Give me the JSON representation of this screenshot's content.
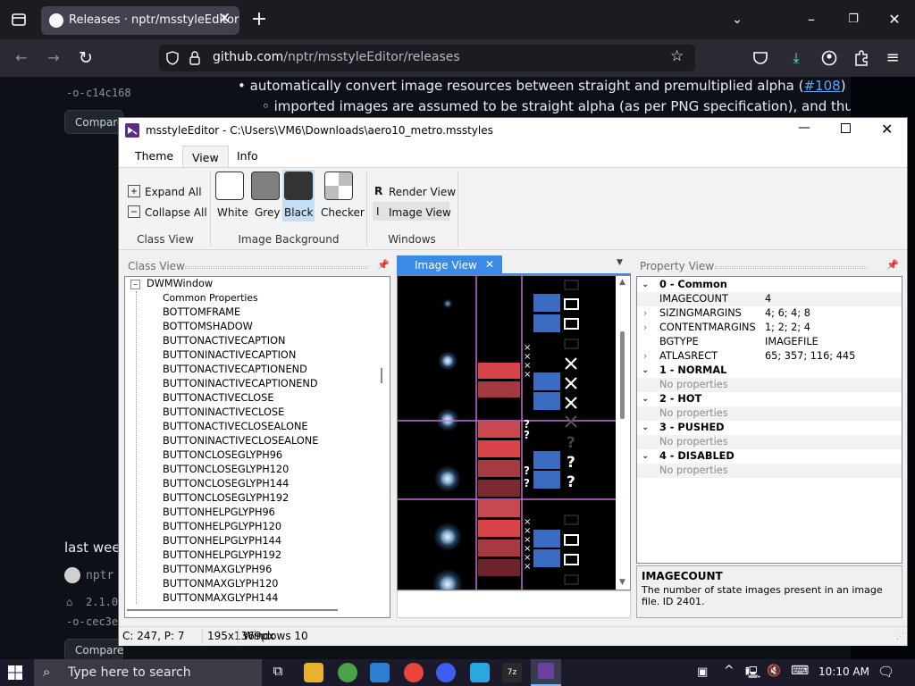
{
  "browser": {
    "tab_title": "Releases · nptr/msstyleEditor",
    "url_domain": "github.com",
    "url_path": "/nptr/msstyleEditor/releases"
  },
  "github": {
    "left_top1": "c14c168",
    "left_compare_top": "Compare",
    "left_last_week": "last week",
    "left_author": "nptr",
    "left_version": "2.1.0",
    "left_commit": "cec3e",
    "left_compare_bottom": "Compare",
    "bullet1_text": "automatically convert image resources between straight and premultiplied alpha (",
    "bullet1_link": "#108",
    "bullet1_end": ")",
    "bullet2_text": "imported images are assumed to be straight alpha (as per PNG specification), and thus"
  },
  "app": {
    "title": "msstyleEditor - C:\\Users\\VM6\\Downloads\\aero10_metro.msstyles",
    "ribbon_tabs": [
      "Theme",
      "View",
      "Info"
    ],
    "active_tab": "View",
    "class_view_group": {
      "expand_all": "Expand All",
      "collapse_all": "Collapse All",
      "label": "Class View"
    },
    "image_background_group": {
      "label": "Image Background",
      "options": [
        {
          "label": "White",
          "color": "#ffffff"
        },
        {
          "label": "Grey",
          "color": "#808080"
        },
        {
          "label": "Black",
          "color": "#333333"
        },
        {
          "label": "Checker",
          "color": "#c0c0c0"
        }
      ],
      "selected": "Black"
    },
    "windows_group": {
      "render_view": "Render View",
      "image_view": "Image View",
      "label": "Windows",
      "render_prefix": "R",
      "image_prefix": "I"
    },
    "class_view": {
      "title": "Class View",
      "root": "DWMWindow",
      "items": [
        "Common Properties",
        "BOTTOMFRAME",
        "BOTTOMSHADOW",
        "BUTTONACTIVECAPTION",
        "BUTTONINACTIVECAPTION",
        "BUTTONACTIVECAPTIONEND",
        "BUTTONINACTIVECAPTIONEND",
        "BUTTONACTIVECLOSE",
        "BUTTONINACTIVECLOSE",
        "BUTTONACTIVECLOSEALONE",
        "BUTTONINACTIVECLOSEALONE",
        "BUTTONCLOSEGLYPH96",
        "BUTTONCLOSEGLYPH120",
        "BUTTONCLOSEGLYPH144",
        "BUTTONCLOSEGLYPH192",
        "BUTTONHELPGLYPH96",
        "BUTTONHELPGLYPH120",
        "BUTTONHELPGLYPH144",
        "BUTTONHELPGLYPH192",
        "BUTTONMAXGLYPH96",
        "BUTTONMAXGLYPH120",
        "BUTTONMAXGLYPH144"
      ]
    },
    "image_view": {
      "tab_label": "Image View"
    },
    "property_view": {
      "title": "Property View",
      "groups": [
        {
          "name": "0 - Common",
          "expanded": true,
          "props": [
            {
              "name": "IMAGECOUNT",
              "value": "4",
              "expandable": false
            },
            {
              "name": "SIZINGMARGINS",
              "value": "4; 6; 4; 8",
              "expandable": true
            },
            {
              "name": "CONTENTMARGINS",
              "value": "1; 2; 2; 4",
              "expandable": true
            },
            {
              "name": "BGTYPE",
              "value": "IMAGEFILE",
              "expandable": false
            },
            {
              "name": "ATLASRECT",
              "value": "65; 357; 116; 445",
              "expandable": true
            }
          ]
        },
        {
          "name": "1 - NORMAL",
          "expanded": true,
          "empty": "No properties"
        },
        {
          "name": "2 - HOT",
          "expanded": true,
          "empty": "No properties"
        },
        {
          "name": "3 - PUSHED",
          "expanded": true,
          "empty": "No properties"
        },
        {
          "name": "4 - DISABLED",
          "expanded": true,
          "empty": "No properties"
        }
      ],
      "desc_title": "IMAGECOUNT",
      "desc_text": "The number of state images present in an image file. ID 2401."
    },
    "status": {
      "cursor": "C: 247, P: 7",
      "size": "195x1369px",
      "platform": "Windows 10"
    }
  },
  "taskbar": {
    "search_placeholder": "Type here to search",
    "time": "10:10 AM"
  },
  "colors": {
    "accent": "#0078d7",
    "image_tab": "#3c8ae8",
    "selected_swatch_bg": "#c4def5"
  }
}
